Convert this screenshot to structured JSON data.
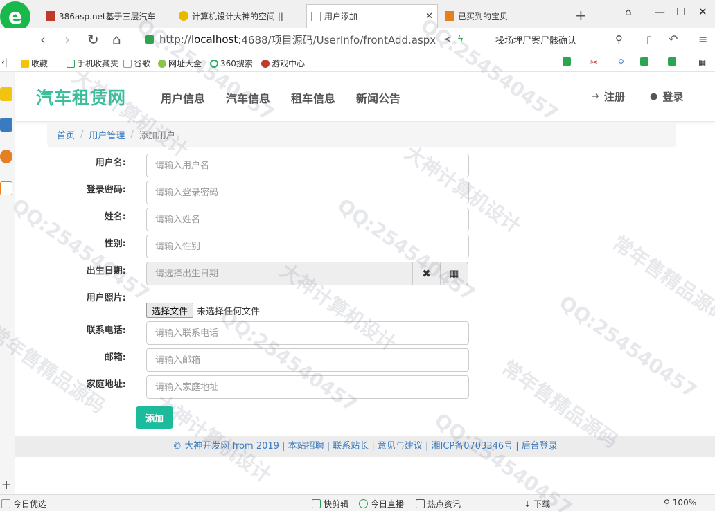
{
  "browser": {
    "tabs": [
      {
        "label": "386asp.net基于三层汽车",
        "color": "#c0392b"
      },
      {
        "label": "计算机设计大神的空间 ||",
        "color": "#e6b800"
      },
      {
        "label": "用户添加",
        "close": "✕"
      },
      {
        "label": "已买到的宝贝",
        "color": "#e67e22"
      }
    ],
    "new_tab": "+",
    "url": {
      "prefix": "http://",
      "host": "localhost",
      "rest": ":4688/项目源码/UserInfo/frontAdd.aspx"
    },
    "search_text": "操场埋尸案尸骸确认",
    "bookmarks": [
      "收藏",
      "手机收藏夹",
      "谷歌",
      "网址大全",
      "360搜索",
      "游戏中心"
    ],
    "bookmark_prefix": "‹|"
  },
  "site": {
    "brand": "汽车租赁网",
    "nav": [
      "用户信息",
      "汽车信息",
      "租车信息",
      "新闻公告"
    ],
    "register": "注册",
    "login": "登录"
  },
  "breadcrumb": {
    "home": "首页",
    "section": "用户管理",
    "current": "添加用户",
    "sep": "/"
  },
  "form": {
    "username": {
      "label": "用户名:",
      "placeholder": "请输入用户名"
    },
    "password": {
      "label": "登录密码:",
      "placeholder": "请输入登录密码"
    },
    "name": {
      "label": "姓名:",
      "placeholder": "请输入姓名"
    },
    "gender": {
      "label": "性别:",
      "placeholder": "请输入性别"
    },
    "birthday": {
      "label": "出生日期:",
      "placeholder": "请选择出生日期"
    },
    "photo": {
      "label": "用户照片:",
      "button": "选择文件",
      "status": "未选择任何文件"
    },
    "phone": {
      "label": "联系电话:",
      "placeholder": "请输入联系电话"
    },
    "email": {
      "label": "邮箱:",
      "placeholder": "请输入邮箱"
    },
    "address": {
      "label": "家庭地址:",
      "placeholder": "请输入家庭地址"
    },
    "submit": "添加"
  },
  "footer": "© 大神开发网 from 2019 | 本站招聘 | 联系站长 | 意见与建议 | 湘ICP备0703346号 | 后台登录",
  "statusbar": {
    "left": "今日优选",
    "items": [
      "快剪辑",
      "今日直播",
      "热点资讯",
      "下载"
    ],
    "zoom": "100%"
  },
  "watermarks": [
    "QQ:254540457",
    "大神计算机设计",
    "常年售精品源码"
  ]
}
